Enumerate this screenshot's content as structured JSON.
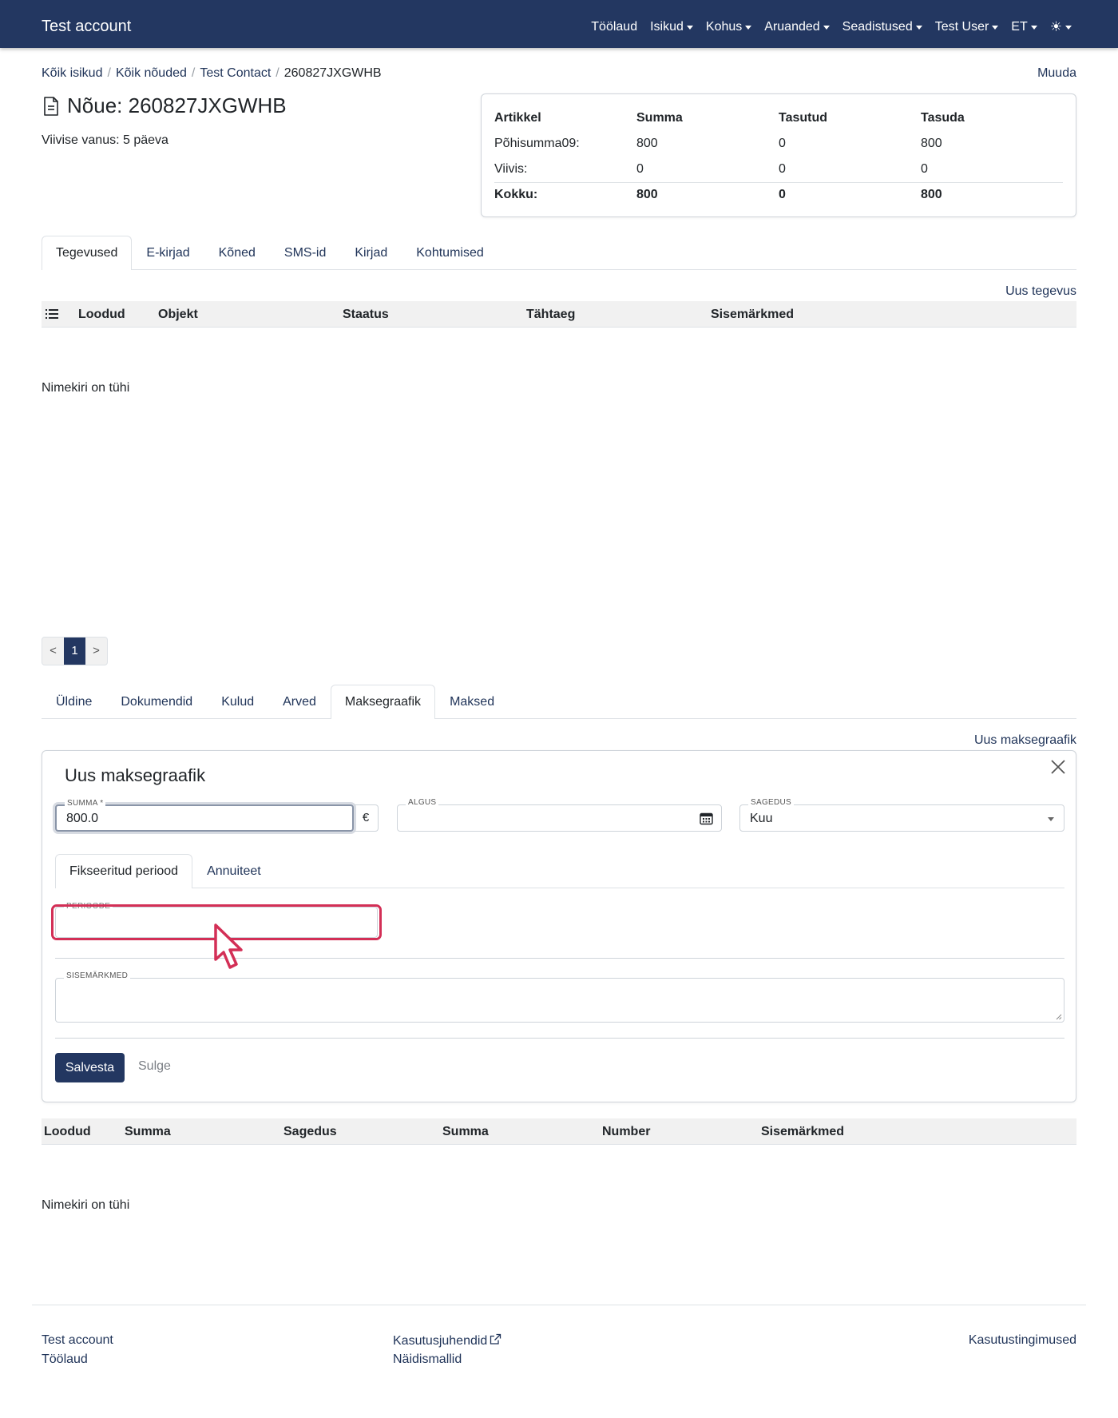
{
  "navbar": {
    "brand": "Test account",
    "items": [
      {
        "label": "Töölaud",
        "dropdown": false
      },
      {
        "label": "Isikud",
        "dropdown": true
      },
      {
        "label": "Kohus",
        "dropdown": true
      },
      {
        "label": "Aruanded",
        "dropdown": true
      },
      {
        "label": "Seadistused",
        "dropdown": true
      },
      {
        "label": "Test User",
        "dropdown": true
      },
      {
        "label": "ET",
        "dropdown": true
      }
    ],
    "theme_icon": "☀"
  },
  "breadcrumb": {
    "items": [
      "Kõik isikud",
      "Kõik nõuded",
      "Test Contact"
    ],
    "current": "260827JXGWHB"
  },
  "edit_label": "Muuda",
  "page": {
    "title": "Nõue: 260827JXGWHB",
    "subtitle": "Viivise vanus: 5 päeva"
  },
  "summary": {
    "headers": [
      "Artikkel",
      "Summa",
      "Tasutud",
      "Tasuda"
    ],
    "rows": [
      [
        "Põhisumma09:",
        "800",
        "0",
        "800"
      ],
      [
        "Viivis:",
        "0",
        "0",
        "0"
      ]
    ],
    "total": [
      "Kokku:",
      "800",
      "0",
      "800"
    ]
  },
  "activity_tabs": {
    "items": [
      "Tegevused",
      "E-kirjad",
      "Kõned",
      "SMS-id",
      "Kirjad",
      "Kohtumised"
    ],
    "active": 0
  },
  "activities": {
    "new_label": "Uus tegevus",
    "columns": [
      "Loodud",
      "Objekt",
      "Staatus",
      "Tähtaeg",
      "Sisemärkmed"
    ],
    "empty": "Nimekiri on tühi"
  },
  "pagination": {
    "prev": "<",
    "current": "1",
    "next": ">"
  },
  "claim_tabs": {
    "items": [
      "Üldine",
      "Dokumendid",
      "Kulud",
      "Arved",
      "Maksegraafik",
      "Maksed"
    ],
    "active": 4
  },
  "schedule": {
    "new_label": "Uus maksegraafik",
    "form": {
      "title": "Uus maksegraafik",
      "sum_label": "SUMMA *",
      "sum_value": "800.0",
      "currency": "€",
      "start_label": "ALGUS",
      "start_value": "",
      "frequency_label": "SAGEDUS",
      "frequency_value": "Kuu",
      "tabs": [
        "Fikseeritud periood",
        "Annuiteet"
      ],
      "active_tab": 0,
      "periods_label": "PERIOODE",
      "periods_value": "",
      "notes_label": "SISEMÄRKMED",
      "notes_value": "",
      "save_label": "Salvesta",
      "close_label": "Sulge"
    },
    "columns": [
      "Loodud",
      "Summa",
      "Sagedus",
      "Summa",
      "Number",
      "Sisemärkmed"
    ],
    "empty": "Nimekiri on tühi"
  },
  "footer": {
    "col1": [
      "Test account",
      "Töölaud"
    ],
    "col2": [
      "Kasutusjuhendid",
      "Näidismallid"
    ],
    "col3": [
      "Kasutustingimused"
    ]
  },
  "colors": {
    "primary": "#233761",
    "link": "#1f3358",
    "highlight": "#d32f56"
  }
}
